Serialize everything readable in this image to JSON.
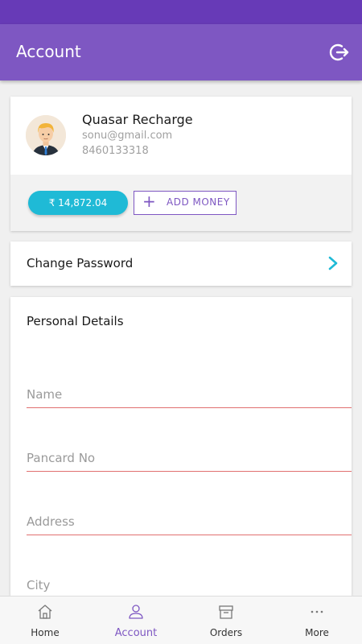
{
  "header": {
    "title": "Account",
    "logout_icon": "logout-icon"
  },
  "profile": {
    "name": "Quasar Recharge",
    "email": "sonu@gmail.com",
    "phone": "8460133318",
    "balance": "₹ 14,872.04",
    "add_money_label": "ADD MONEY"
  },
  "change_password": {
    "label": "Change Password"
  },
  "personal_details": {
    "title": "Personal Details",
    "fields": [
      {
        "placeholder": "Name",
        "value": ""
      },
      {
        "placeholder": "Pancard No",
        "value": ""
      },
      {
        "placeholder": "Address",
        "value": ""
      },
      {
        "placeholder": "City",
        "value": ""
      }
    ]
  },
  "bottom_nav": {
    "items": [
      {
        "label": "Home",
        "icon": "home-icon"
      },
      {
        "label": "Account",
        "icon": "user-icon",
        "active": true
      },
      {
        "label": "Orders",
        "icon": "archive-icon"
      },
      {
        "label": "More",
        "icon": "more-icon"
      }
    ]
  },
  "colors": {
    "primary": "#7e57c2",
    "status_bar": "#673ab7",
    "accent": "#1fbad6",
    "field_underline": "#e07070"
  }
}
